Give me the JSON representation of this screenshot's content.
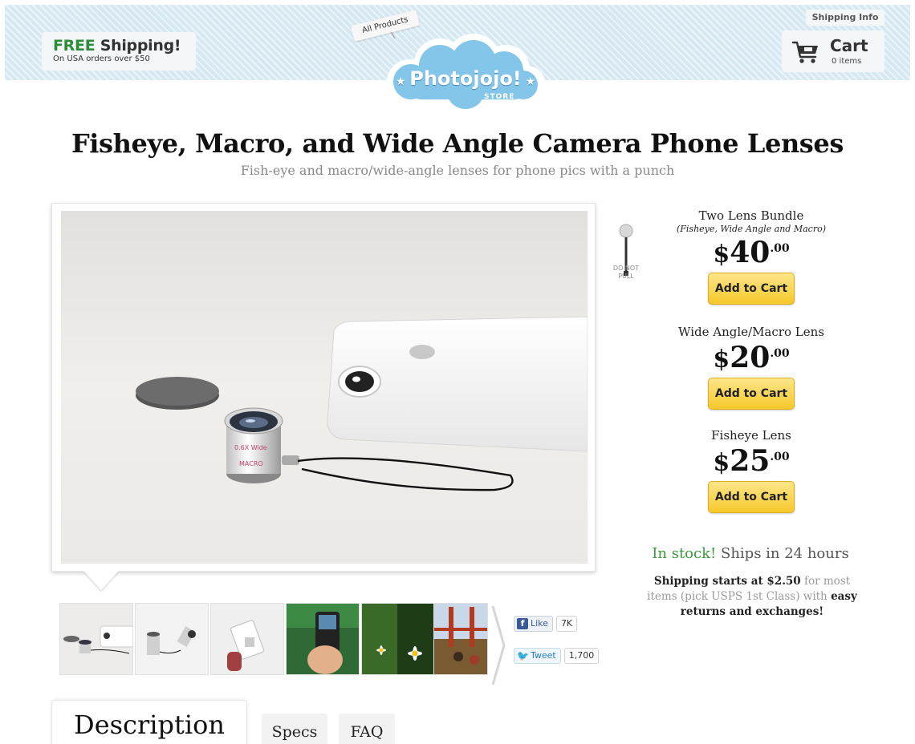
{
  "header": {
    "free_shipping": {
      "highlight": "FREE",
      "text": "Shipping!",
      "note": "On USA orders over $50"
    },
    "shipping_info_label": "Shipping Info",
    "cart": {
      "label": "Cart",
      "count": "0 items"
    },
    "all_products_label": "All Products",
    "logo": {
      "text": "Photojojo!",
      "sub": "STORE"
    }
  },
  "page": {
    "title": "Fisheye, Macro, and Wide Angle Camera Phone Lenses",
    "subtitle": "Fish-eye and macro/wide-angle lenses for phone pics with a punch"
  },
  "do_not_pull": {
    "line1": "DO NOT",
    "line2": "PULL"
  },
  "products": [
    {
      "name": "Two Lens Bundle",
      "sub": "(Fisheye, Wide Angle and Macro)",
      "currency": "$",
      "price": "40",
      "cents": ".00",
      "button": "Add to Cart"
    },
    {
      "name": "Wide Angle/Macro Lens",
      "sub": "",
      "currency": "$",
      "price": "20",
      "cents": ".00",
      "button": "Add to Cart"
    },
    {
      "name": "Fisheye Lens",
      "sub": "",
      "currency": "$",
      "price": "25",
      "cents": ".00",
      "button": "Add to Cart"
    }
  ],
  "stock": {
    "status": "In stock!",
    "detail": "Ships in 24 hours"
  },
  "shipping_note": {
    "bold1": "Shipping starts at $2.50",
    "plain1": "for most items (pick USPS 1st Class) with",
    "bold2": "easy returns and exchanges!"
  },
  "photo_lens_labels": {
    "label1": "0.6X Wide",
    "label2": "MACRO"
  },
  "social": {
    "like": {
      "label": "Like",
      "count": "7K"
    },
    "tweet": {
      "label": "Tweet",
      "count": "1,700"
    }
  },
  "tabs": [
    {
      "label": "Description"
    },
    {
      "label": "Specs"
    },
    {
      "label": "FAQ"
    }
  ],
  "colors": {
    "header_bg": "#d6e8f2",
    "accent_green": "#2e8b3a",
    "button_yellow": "#f6c92a",
    "cloud_blue": "#7cc0e6"
  }
}
